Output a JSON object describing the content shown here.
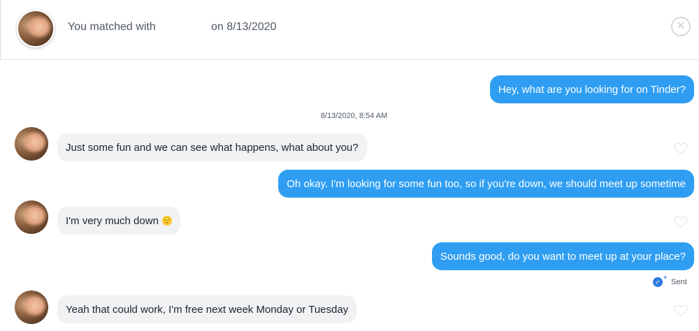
{
  "header": {
    "matched_prefix": "You matched with",
    "matched_date": "on 8/13/2020",
    "close_symbol": "✕"
  },
  "conversation": {
    "timestamp": "8/13/2020, 8:54 AM",
    "messages": [
      {
        "direction": "outgoing",
        "text": "Hey, what are you looking for on Tinder?"
      },
      {
        "direction": "incoming",
        "text": "Just some fun and we can see what happens, what about you?"
      },
      {
        "direction": "outgoing",
        "text": "Oh okay. I'm looking for some fun too, so if you're down, we should meet up sometime"
      },
      {
        "direction": "incoming",
        "text": "I'm very much down",
        "emoji": "😌"
      },
      {
        "direction": "outgoing",
        "text": "Sounds good, do you want to meet up at your place?"
      },
      {
        "direction": "incoming",
        "text": "Yeah that could work, I'm free next week Monday or Tuesday"
      }
    ],
    "sent_status": "Sent"
  },
  "colors": {
    "outgoing_bubble": "#2f9ef2",
    "incoming_bubble": "#f0f2f4",
    "sent_icon": "#2f7be0"
  }
}
